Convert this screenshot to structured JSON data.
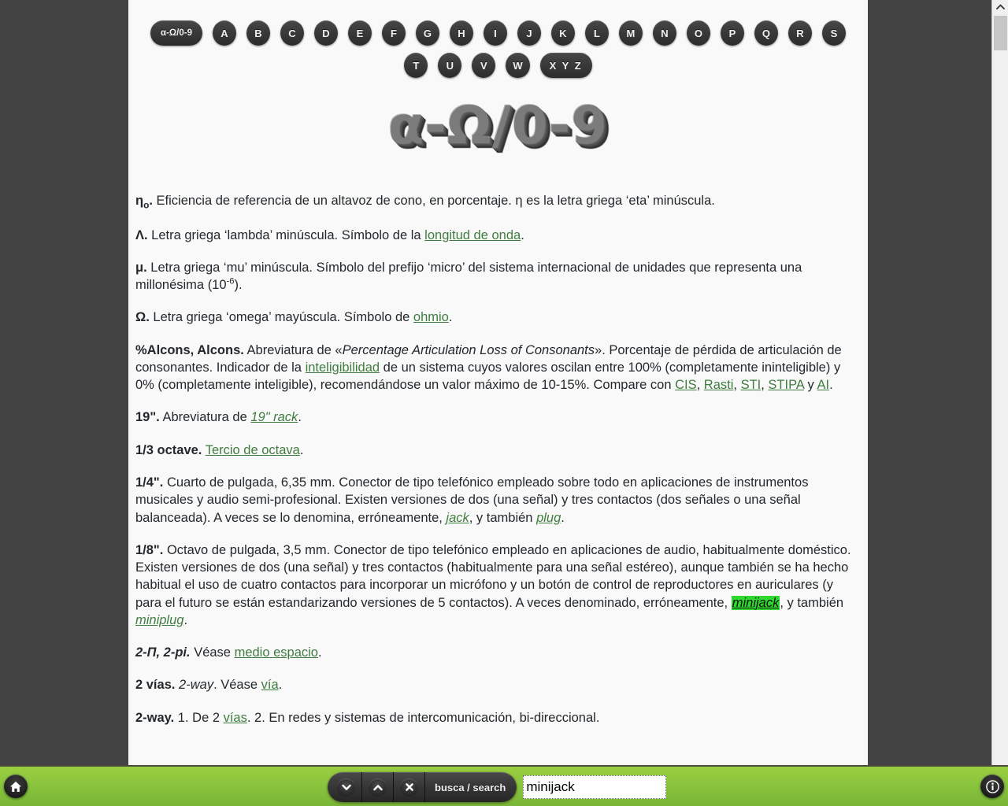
{
  "nav": {
    "row1": [
      {
        "label": "α-Ω/0-9",
        "name": "nav-alpha-omega",
        "wide": true
      },
      {
        "label": "A",
        "name": "nav-a"
      },
      {
        "label": "B",
        "name": "nav-b"
      },
      {
        "label": "C",
        "name": "nav-c"
      },
      {
        "label": "D",
        "name": "nav-d"
      },
      {
        "label": "E",
        "name": "nav-e"
      },
      {
        "label": "F",
        "name": "nav-f"
      },
      {
        "label": "G",
        "name": "nav-g"
      },
      {
        "label": "H",
        "name": "nav-h"
      },
      {
        "label": "I",
        "name": "nav-i"
      },
      {
        "label": "J",
        "name": "nav-j"
      },
      {
        "label": "K",
        "name": "nav-k"
      },
      {
        "label": "L",
        "name": "nav-l"
      },
      {
        "label": "M",
        "name": "nav-m"
      },
      {
        "label": "N",
        "name": "nav-n"
      },
      {
        "label": "O",
        "name": "nav-o"
      },
      {
        "label": "P",
        "name": "nav-p"
      },
      {
        "label": "Q",
        "name": "nav-q"
      },
      {
        "label": "R",
        "name": "nav-r"
      },
      {
        "label": "S",
        "name": "nav-s"
      }
    ],
    "row2": [
      {
        "label": "T",
        "name": "nav-t"
      },
      {
        "label": "U",
        "name": "nav-u"
      },
      {
        "label": "V",
        "name": "nav-v"
      },
      {
        "label": "W",
        "name": "nav-w"
      },
      {
        "label": "X Y Z",
        "name": "nav-xyz",
        "xyz": true
      }
    ]
  },
  "page_title": "α-Ω/0-9",
  "entries": {
    "eta0": {
      "term": "η",
      "term_sub": "o",
      "term_tail": ".",
      "text": " Eficiencia de referencia de un altavoz de cono, en porcentaje. η es la letra griega ‘eta’ minúscula."
    },
    "lambda": {
      "term": "Λ.",
      "t1": " Letra griega ‘lambda’ minúscula. Símbolo de la ",
      "link1": "longitud de onda",
      "t2": "."
    },
    "mu": {
      "term": "μ.",
      "t1": " Letra griega ‘mu’ minúscula. Símbolo del prefijo ‘micro’ del sistema internacional de unidades que representa una millonésima (10",
      "sup": "-6",
      "t2": ")."
    },
    "omega": {
      "term": "Ω.",
      "t1": " Letra griega ‘omega’ mayúscula. Símbolo de ",
      "link1": "ohmio",
      "t2": "."
    },
    "alcons": {
      "term": "%Alcons, Alcons.",
      "t1": " Abreviatura de «",
      "ital1": "Percentage Articulation Loss of Consonants",
      "t2": "». Porcentaje de pérdida de articulación de consonantes. Indicador de la ",
      "link1": "inteligibilidad",
      "t3": " de un sistema cuyos valores oscilan entre 100% (completamente ininteligible) y 0% (completamente inteligible), recomendándose un valor máximo de 10-15%. Compare con ",
      "link2": "CIS",
      "t4": ", ",
      "link3": "Rasti",
      "t5": ", ",
      "link4": "STI",
      "t6": ", ",
      "link5": "STIPA",
      "t7": " y ",
      "link6": "AI",
      "t8": "."
    },
    "inch19": {
      "term": "19\".",
      "t1": " Abreviatura de ",
      "link1": "19\" rack",
      "t2": "."
    },
    "octave13": {
      "term": "1/3 octave.",
      "t1": " ",
      "link1": "Tercio de octava",
      "t2": "."
    },
    "quarter": {
      "term": "1/4\".",
      "t1": " Cuarto de pulgada, 6,35 mm. Conector de tipo telefónico empleado sobre todo en aplicaciones de instrumentos musicales y audio semi-profesional. Existen versiones de dos (una señal) y tres contactos (dos señales o una señal balanceada). A veces se lo denomina, erróneamente, ",
      "link1": "jack",
      "t2": ", y también ",
      "link2": "plug",
      "t3": "."
    },
    "eighth": {
      "term": "1/8\".",
      "t1": " Octavo de pulgada, 3,5 mm. Conector de tipo telefónico empleado en aplicaciones de audio, habitualmente doméstico. Existen versiones de dos (una señal) y tres contactos (habitualmente para una señal estéreo), aunque también se ha hecho habitual el uso de cuatro contactos para incorporar un micrófono y un botón de control de reproductores en auriculares (y para el futuro se están estandarizando versiones de 5 contactos). A veces denominado, erróneamente, ",
      "highlight": "minijack",
      "t2": ", y también ",
      "link2": "miniplug",
      "t3": "."
    },
    "twopi": {
      "term": "2-Π, 2-pi.",
      "t1": " Véase ",
      "link1": "medio espacio",
      "t2": "."
    },
    "dosvias": {
      "term": "2 vías.",
      "ital1": " 2-way",
      "t1": ". Véase ",
      "link1": "vía",
      "t2": "."
    },
    "twoway": {
      "term": "2-way.",
      "t1": " 1. De 2 ",
      "link1": "vías",
      "t2": ". 2. En redes y sistemas de intercomunicación, bi-direccional."
    }
  },
  "findbar": {
    "next_icon": "chevron-down-icon",
    "prev_icon": "chevron-up-icon",
    "close_icon": "close-x-icon",
    "label": "busca / search",
    "query": "minijack",
    "placeholder": ""
  },
  "toolbar": {
    "home_icon": "home-icon",
    "info_icon": "info-icon"
  },
  "colors": {
    "accent_green": "#8cc63f",
    "link_green": "#3f7d3f",
    "highlight_green": "#2ed82e",
    "chrome_dark": "#434343",
    "page_bg": "#f9f9f9"
  }
}
